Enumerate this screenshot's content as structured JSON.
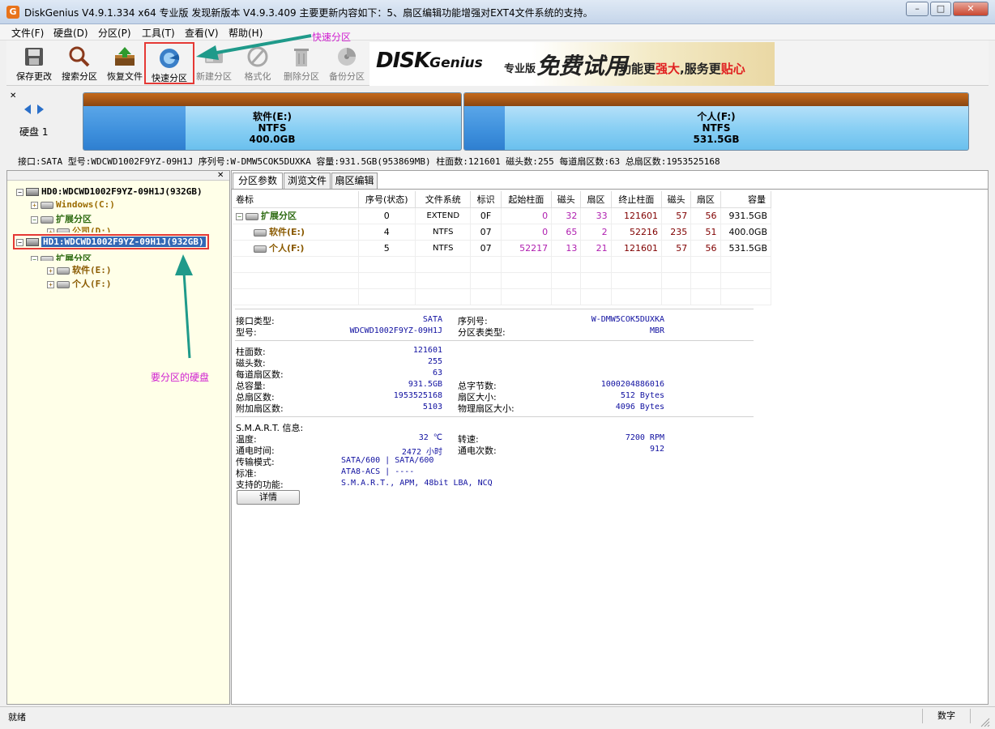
{
  "window": {
    "title": "DiskGenius V4.9.1.334 x64 专业版   发现新版本 V4.9.3.409 主要更新内容如下：5、扇区编辑功能增强对EXT4文件系统的支持。",
    "app_icon_glyph": "G",
    "minimize": "–",
    "maximize": "□",
    "close": "✕"
  },
  "menu": [
    "文件(F)",
    "硬盘(D)",
    "分区(P)",
    "工具(T)",
    "查看(V)",
    "帮助(H)"
  ],
  "toolbar": {
    "buttons": [
      {
        "label": "保存更改",
        "icon": "save-icon",
        "enabled": true
      },
      {
        "label": "搜索分区",
        "icon": "search-icon",
        "enabled": true
      },
      {
        "label": "恢复文件",
        "icon": "recover-file-icon",
        "enabled": true
      },
      {
        "label": "快速分区",
        "icon": "quick-partition-icon",
        "enabled": true
      },
      {
        "label": "新建分区",
        "icon": "new-partition-icon",
        "enabled": false
      },
      {
        "label": "格式化",
        "icon": "format-icon",
        "enabled": false
      },
      {
        "label": "删除分区",
        "icon": "delete-partition-icon",
        "enabled": false
      },
      {
        "label": "备份分区",
        "icon": "backup-partition-icon",
        "enabled": false
      }
    ],
    "banner": {
      "logo": "DISKGenius",
      "logo_main": "DISK",
      "logo_sub": "Genius",
      "edition": "专业版",
      "free": "免费试用",
      "slogan_a": "功能更",
      "slogan_b": "强大",
      "slogan_c": ",服务更",
      "slogan_d": "贴心"
    }
  },
  "annotations": {
    "quick_partition": "快速分区",
    "target_disk": "要分区的硬盘"
  },
  "disk_bar": {
    "label": "硬盘 1",
    "partitions": [
      {
        "name": "软件(E:)",
        "fs": "NTFS",
        "size": "400.0GB",
        "used_fraction": 0.27
      },
      {
        "name": "个人(F:)",
        "fs": "NTFS",
        "size": "531.5GB",
        "used_fraction": 0.08
      }
    ],
    "info": "接口:SATA  型号:WDCWD1002F9YZ-09H1J  序列号:W-DMW5COK5DUXKA  容量:931.5GB(953869MB)  柱面数:121601  磁头数:255  每道扇区数:63  总扇区数:1953525168"
  },
  "tree": {
    "hd0": "HD0:WDCWD1002F9YZ-09H1J(932GB)",
    "hd0_windows": "Windows(C:)",
    "hd0_ext": "扩展分区",
    "hd0_public": "公司(D:)",
    "hd1": "HD1:WDCWD1002F9YZ-09H1J(932GB)",
    "hd1_ext": "扩展分区",
    "hd1_soft": "软件(E:)",
    "hd1_personal": "个人(F:)"
  },
  "tabs": [
    "分区参数",
    "浏览文件",
    "扇区编辑"
  ],
  "partition_table": {
    "headers": [
      "卷标",
      "序号(状态)",
      "文件系统",
      "标识",
      "起始柱面",
      "磁头",
      "扇区",
      "终止柱面",
      "磁头",
      "扇区",
      "容量"
    ],
    "rows": [
      {
        "label": "扩展分区",
        "index": "0",
        "fs": "EXTEND",
        "id": "0F",
        "start_cyl": "0",
        "start_head": "32",
        "start_sec": "33",
        "end_cyl": "121601",
        "end_head": "57",
        "end_sec": "56",
        "size": "931.5GB"
      },
      {
        "label": "软件(E:)",
        "index": "4",
        "fs": "NTFS",
        "id": "07",
        "start_cyl": "0",
        "start_head": "65",
        "start_sec": "2",
        "end_cyl": "52216",
        "end_head": "235",
        "end_sec": "51",
        "size": "400.0GB"
      },
      {
        "label": "个人(F:)",
        "index": "5",
        "fs": "NTFS",
        "id": "07",
        "start_cyl": "52217",
        "start_head": "13",
        "start_sec": "21",
        "end_cyl": "121601",
        "end_head": "57",
        "end_sec": "56",
        "size": "531.5GB"
      }
    ]
  },
  "details": {
    "interface_label": "接口类型:",
    "interface": "SATA",
    "serial_label": "序列号:",
    "serial": "W-DMW5COK5DUXKA",
    "model_label": "型号:",
    "model": "WDCWD1002F9YZ-09H1J",
    "ptype_label": "分区表类型:",
    "ptype": "MBR",
    "cyl_label": "柱面数:",
    "cyl": "121601",
    "heads_label": "磁头数:",
    "heads": "255",
    "spt_label": "每道扇区数:",
    "spt": "63",
    "cap_label": "总容量:",
    "cap": "931.5GB",
    "bytes_label": "总字节数:",
    "bytes": "1000204886016",
    "sectors_label": "总扇区数:",
    "sectors": "1953525168",
    "secsize_label": "扇区大小:",
    "secsize": "512 Bytes",
    "extra_label": "附加扇区数:",
    "extra": "5103",
    "physsec_label": "物理扇区大小:",
    "physsec": "4096 Bytes",
    "smart_label": "S.M.A.R.T. 信息:",
    "temp_label": "温度:",
    "temp": "32 ℃",
    "speed_label": "转速:",
    "speed": "7200 RPM",
    "hours_label": "通电时间:",
    "hours": "2472 小时",
    "count_label": "通电次数:",
    "count": "912",
    "mode_label": "传输模式:",
    "mode": "SATA/600 | SATA/600",
    "std_label": "标准:",
    "std": "ATA8-ACS | ----",
    "feat_label": "支持的功能:",
    "feat": "S.M.A.R.T., APM, 48bit LBA, NCQ",
    "detail_button": "详情"
  },
  "status": {
    "text": "就绪",
    "numlock": "数字"
  }
}
